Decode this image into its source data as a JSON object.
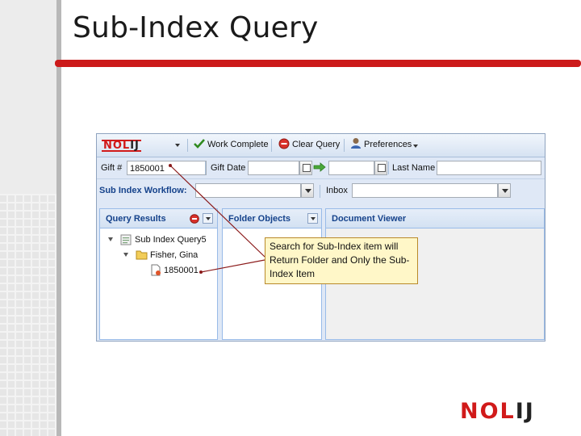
{
  "slide": {
    "title": "Sub-Index Query",
    "accent_color": "#cc1a1a"
  },
  "toolbar": {
    "logo_text_red": "NOL",
    "logo_text_dark": "IJ",
    "work_complete_label": "Work Complete",
    "clear_query_label": "Clear Query",
    "preferences_label": "Preferences"
  },
  "search_row": {
    "gift_label": "Gift #",
    "gift_value": "1850001",
    "gift_date_label": "Gift Date",
    "gift_date_from": "",
    "gift_date_to": "",
    "last_name_label": "Last Name",
    "last_name_value": ""
  },
  "workflow_row": {
    "workflow_label": "Sub Index Workflow:",
    "workflow_value": "",
    "inbox_label": "Inbox",
    "inbox_value": ""
  },
  "panels": {
    "query_results": {
      "title": "Query Results",
      "tree": {
        "query": "Sub Index Query5",
        "folder": "Fisher, Gina",
        "item": "1850001"
      }
    },
    "folder_objects": {
      "title": "Folder Objects"
    },
    "document_viewer": {
      "title": "Document Viewer"
    }
  },
  "callout": {
    "text": "Search for Sub-Index item will Return Folder and Only the Sub-Index Item"
  },
  "footer": {
    "logo_red": "NOL",
    "logo_dark": "IJ"
  }
}
